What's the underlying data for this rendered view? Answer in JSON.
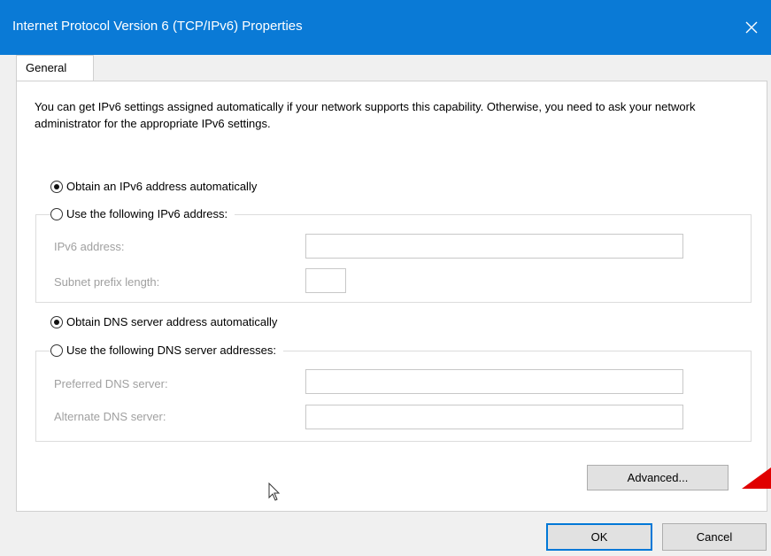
{
  "window": {
    "title": "Internet Protocol Version 6 (TCP/IPv6) Properties",
    "close_icon": "close-icon",
    "titlebar_color": "#0a7ad6"
  },
  "tabs": [
    {
      "label": "General",
      "selected": true
    }
  ],
  "description": "You can get IPv6 settings assigned automatically if your network supports this capability. Otherwise, you need to ask your network administrator for the appropriate IPv6 settings.",
  "ipv6": {
    "auto_label": "Obtain an IPv6 address automatically",
    "auto_checked": true,
    "manual_label": "Use the following IPv6 address:",
    "manual_checked": false,
    "address_label": "IPv6 address:",
    "address_value": "",
    "prefix_label": "Subnet prefix length:",
    "prefix_value": ""
  },
  "dns": {
    "auto_label": "Obtain DNS server address automatically",
    "auto_checked": true,
    "manual_label": "Use the following DNS server addresses:",
    "manual_checked": false,
    "preferred_label": "Preferred DNS server:",
    "preferred_value": "",
    "alternate_label": "Alternate DNS server:",
    "alternate_value": ""
  },
  "buttons": {
    "advanced": "Advanced...",
    "ok": "OK",
    "cancel": "Cancel"
  },
  "annotation_color": "#e00000"
}
